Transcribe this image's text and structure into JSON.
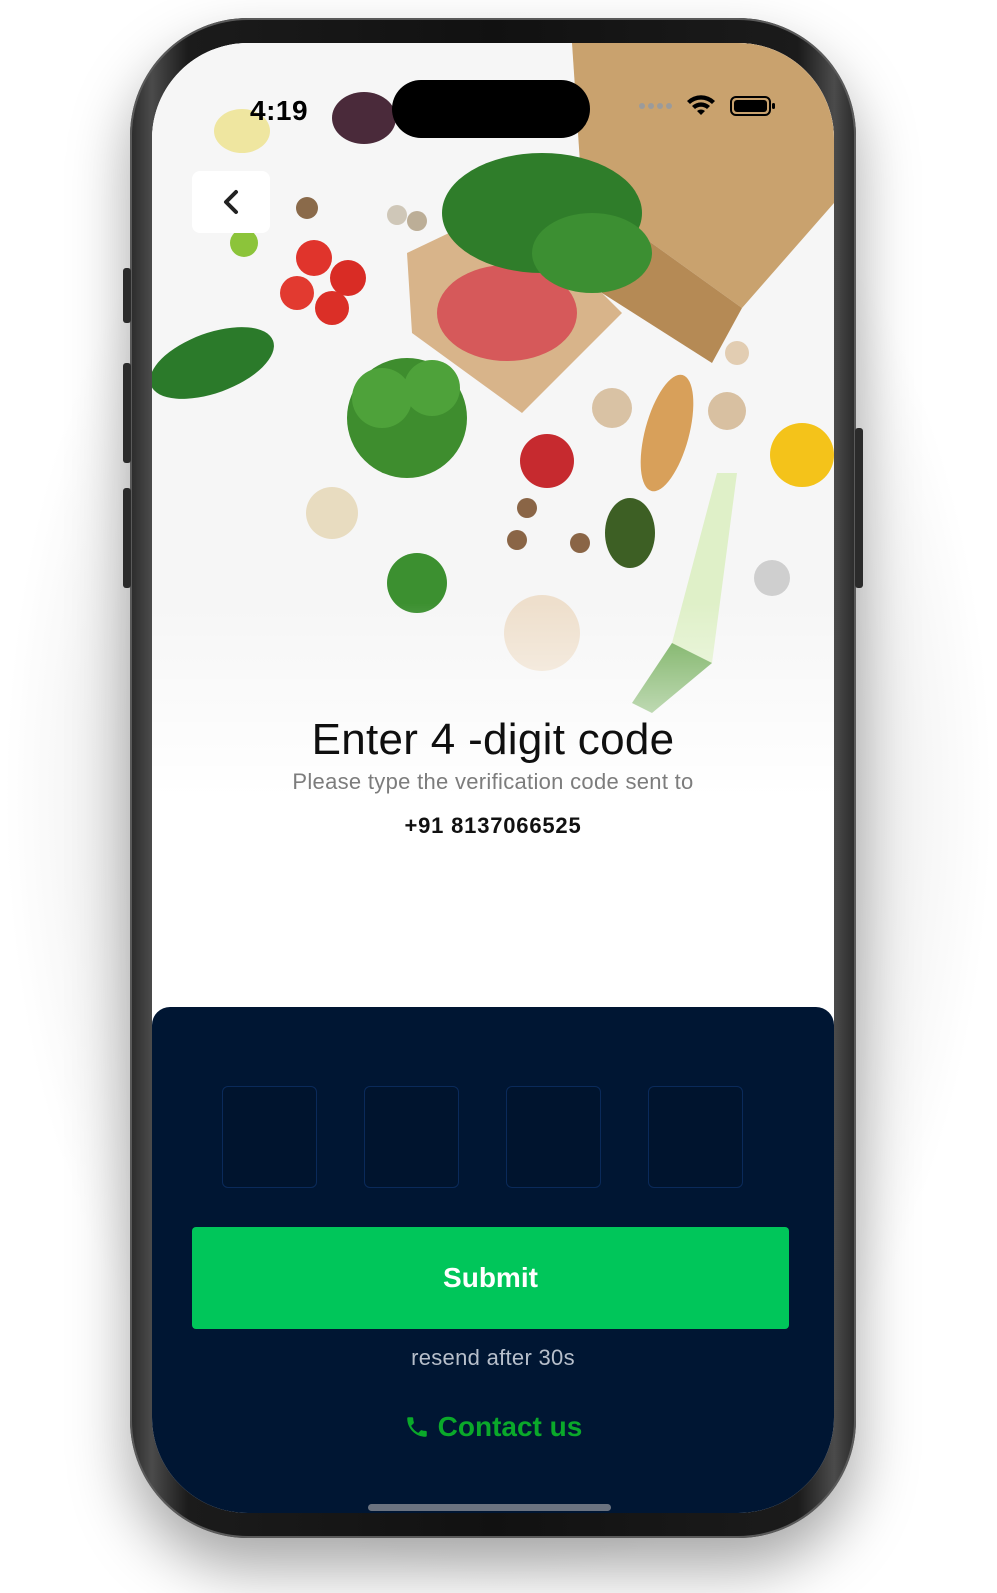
{
  "status_bar": {
    "time": "4:19"
  },
  "header": {
    "back_icon": "chevron-left-icon"
  },
  "verification": {
    "title": "Enter 4 -digit code",
    "subtitle": "Please type the verification code sent to",
    "phone_number": "+91 8137066525"
  },
  "otp": {
    "digits": [
      "",
      "",
      "",
      ""
    ]
  },
  "actions": {
    "submit_label": "Submit",
    "resend_text": "resend after 30s",
    "contact_label": "Contact us",
    "contact_icon": "phone-icon"
  },
  "colors": {
    "sheet_background": "#001633",
    "submit_green": "#00c65a",
    "contact_green": "#0aa92a"
  }
}
